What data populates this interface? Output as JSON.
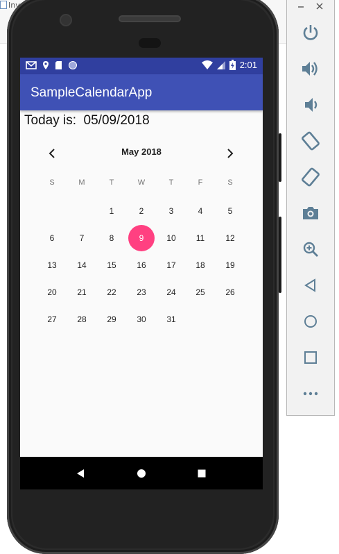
{
  "host": {
    "tab_label": "Inve"
  },
  "status_bar": {
    "time": "2:01",
    "left_icons": [
      "gmail-icon",
      "location-icon",
      "sd-card-icon",
      "sync-circle-icon"
    ],
    "right_icons": [
      "wifi-icon",
      "cell-signal-icon",
      "battery-icon"
    ]
  },
  "app": {
    "title": "SampleCalendarApp",
    "accent_color": "#3f51b5",
    "status_color": "#303f9f",
    "selected_color": "#ff4081"
  },
  "today_label": "Today is:  05/09/2018",
  "calendar": {
    "month_label": "May 2018",
    "weekdays": [
      "S",
      "M",
      "T",
      "W",
      "T",
      "F",
      "S"
    ],
    "weeks": [
      [
        "",
        "",
        "1",
        "2",
        "3",
        "4",
        "5"
      ],
      [
        "6",
        "7",
        "8",
        "9",
        "10",
        "11",
        "12"
      ],
      [
        "13",
        "14",
        "15",
        "16",
        "17",
        "18",
        "19"
      ],
      [
        "20",
        "21",
        "22",
        "23",
        "24",
        "25",
        "26"
      ],
      [
        "27",
        "28",
        "29",
        "30",
        "31",
        "",
        ""
      ]
    ],
    "selected_day": "9"
  },
  "android_nav": [
    "back-icon",
    "home-icon",
    "recents-icon"
  ],
  "emulator": {
    "window_controls": [
      "minimize-icon",
      "close-icon"
    ],
    "buttons": [
      "power-icon",
      "volume-up-icon",
      "volume-down-icon",
      "rotate-left-icon",
      "rotate-right-icon",
      "camera-icon",
      "zoom-icon",
      "back-icon",
      "home-icon",
      "overview-icon",
      "more-icon"
    ]
  }
}
